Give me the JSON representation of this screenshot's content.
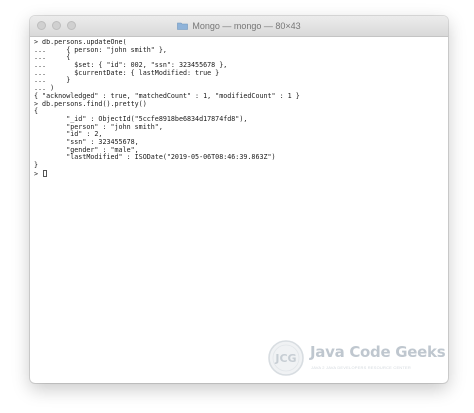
{
  "window": {
    "title": "Mongo — mongo — 80×43"
  },
  "terminal": {
    "lines": [
      "> db.persons.updateOne(",
      "...     { person: \"john smith\" },",
      "...     {",
      "...       $set: { \"id\": 002, \"ssn\": 323455678 },",
      "...       $currentDate: { lastModified: true }",
      "...     }",
      "... )",
      "{ \"acknowledged\" : true, \"matchedCount\" : 1, \"modifiedCount\" : 1 }",
      "> db.persons.find().pretty()",
      "{",
      "        \"_id\" : ObjectId(\"5ccfe8918be6834d17874fd8\"),",
      "        \"person\" : \"john smith\",",
      "        \"id\" : 2,",
      "        \"ssn\" : 323455678,",
      "        \"gender\" : \"male\",",
      "        \"lastModified\" : ISODate(\"2019-05-06T08:46:39.863Z\")",
      "}"
    ],
    "prompt": "> "
  },
  "watermark": {
    "logo_text": "JCG",
    "name": "Java Code Geeks",
    "tagline": "JAVA 2 JAVA DEVELOPERS RESOURCE CENTER"
  }
}
